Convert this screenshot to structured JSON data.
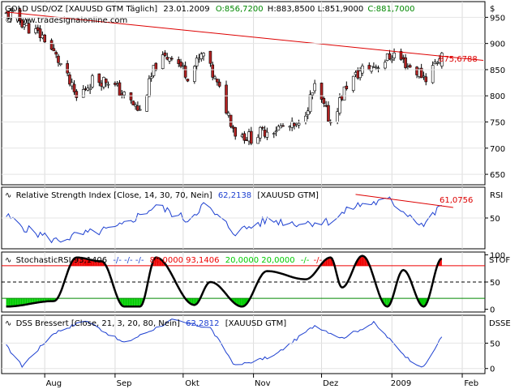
{
  "currency_label": "$",
  "main": {
    "symbol_label": "GOLD USD/OZ [XAUUSD GTM  Täglich]",
    "date": "23.01.2009",
    "open_label": "O:856,7200",
    "hl_label": "H:883,8500  L:851,9000",
    "close_label": "C:881,7000",
    "website": "© www.tradesignalonline.com",
    "trendline_value": "875,6788",
    "y_ticks": [
      "950",
      "900",
      "850",
      "800",
      "750",
      "700",
      "650"
    ]
  },
  "rsi": {
    "header": "Relative Strength Index [Close, 14, 30, 70, Nein]",
    "value": "62,2138",
    "symbol": "[XAUUSD GTM]",
    "trendline_value": "61,0756",
    "axis_label": "RSI",
    "y_ticks": [
      "50"
    ]
  },
  "stoch": {
    "header": "StochasticRSI 93,1406",
    "dashes": "-/- -/- -/-",
    "red_values": "80,0000 93,1406",
    "green_values": "20,0000 20,0000",
    "tail_green": "-/-",
    "tail_red": "-/-",
    "axis_label": "STOF",
    "y_ticks": [
      "100",
      "50",
      "0"
    ]
  },
  "dss": {
    "header": "DSS Bressert [Close, 21, 3, 20, 80, Nein]",
    "value": "62,2812",
    "symbol": "[XAUUSD GTM]",
    "axis_label": "DSSE",
    "y_ticks": [
      "50",
      "0"
    ]
  },
  "x_ticks": [
    "Aug",
    "Sep",
    "Okt",
    "Nov",
    "Dez",
    "2009",
    "Feb"
  ],
  "colors": {
    "up_candle": "#ffffff",
    "down_candle": "#b22222",
    "trendline": "#dd0000",
    "indicator_line": "#1c3fd0",
    "open_value": "#008800",
    "close_value": "#008800",
    "stoch_overbought": "#ee0000",
    "stoch_oversold": "#00cc00"
  },
  "chart_data": [
    {
      "type": "candlestick",
      "title": "GOLD USD/OZ [XAUUSD GTM  Täglich] 23.01.2009",
      "ylabel": "$",
      "ylim": [
        630,
        980
      ],
      "last_ohlc": {
        "open": 856.72,
        "high": 883.85,
        "low": 851.9,
        "close": 881.7
      },
      "approx_closes": [
        {
          "x": "2008-07-18",
          "y": 955
        },
        {
          "x": "2008-07-25",
          "y": 930
        },
        {
          "x": "2008-08-01",
          "y": 910
        },
        {
          "x": "2008-08-08",
          "y": 860
        },
        {
          "x": "2008-08-15",
          "y": 795
        },
        {
          "x": "2008-08-22",
          "y": 830
        },
        {
          "x": "2008-08-29",
          "y": 830
        },
        {
          "x": "2008-09-05",
          "y": 800
        },
        {
          "x": "2008-09-12",
          "y": 770
        },
        {
          "x": "2008-09-19",
          "y": 860
        },
        {
          "x": "2008-09-26",
          "y": 880
        },
        {
          "x": "2008-10-03",
          "y": 840
        },
        {
          "x": "2008-10-10",
          "y": 880
        },
        {
          "x": "2008-10-17",
          "y": 810
        },
        {
          "x": "2008-10-24",
          "y": 730
        },
        {
          "x": "2008-10-31",
          "y": 720
        },
        {
          "x": "2008-11-07",
          "y": 735
        },
        {
          "x": "2008-11-14",
          "y": 740
        },
        {
          "x": "2008-11-21",
          "y": 740
        },
        {
          "x": "2008-11-28",
          "y": 815
        },
        {
          "x": "2008-12-05",
          "y": 750
        },
        {
          "x": "2008-12-12",
          "y": 820
        },
        {
          "x": "2008-12-19",
          "y": 850
        },
        {
          "x": "2008-12-26",
          "y": 860
        },
        {
          "x": "2009-01-02",
          "y": 880
        },
        {
          "x": "2009-01-09",
          "y": 855
        },
        {
          "x": "2009-01-16",
          "y": 835
        },
        {
          "x": "2009-01-23",
          "y": 881.7
        }
      ],
      "trendline": {
        "x": [
          "2008-07-15",
          "2009-01-23"
        ],
        "y": [
          960,
          875.68
        ]
      },
      "x_ticks": [
        "Aug",
        "Sep",
        "Okt",
        "Nov",
        "Dez",
        "2009",
        "Feb"
      ],
      "y_ticks": [
        950,
        900,
        850,
        800,
        750,
        700,
        650
      ]
    },
    {
      "type": "line",
      "title": "Relative Strength Index [Close, 14, 30, 70, Nein] 62,2138 [XAUUSD GTM]",
      "ylim": [
        20,
        80
      ],
      "series": [
        {
          "name": "Relative Strength Index",
          "values": [
            {
              "x": "2008-07-15",
              "y": 52
            },
            {
              "x": "2008-07-25",
              "y": 38
            },
            {
              "x": "2008-08-06",
              "y": 28
            },
            {
              "x": "2008-08-15",
              "y": 33
            },
            {
              "x": "2008-09-02",
              "y": 40
            },
            {
              "x": "2008-09-19",
              "y": 62
            },
            {
              "x": "2008-10-03",
              "y": 48
            },
            {
              "x": "2008-10-10",
              "y": 63
            },
            {
              "x": "2008-10-24",
              "y": 36
            },
            {
              "x": "2008-11-07",
              "y": 48
            },
            {
              "x": "2008-11-21",
              "y": 45
            },
            {
              "x": "2008-12-05",
              "y": 47
            },
            {
              "x": "2008-12-16",
              "y": 62
            },
            {
              "x": "2008-12-31",
              "y": 67
            },
            {
              "x": "2009-01-15",
              "y": 43
            },
            {
              "x": "2009-01-23",
              "y": 62.21
            }
          ]
        }
      ],
      "trendline": {
        "x": [
          "2008-12-16",
          "2009-01-23"
        ],
        "y": [
          73,
          61.08
        ]
      },
      "y_ticks": [
        50
      ]
    },
    {
      "type": "line",
      "title": "StochasticRSI 93,1406",
      "ylim": [
        -5,
        105
      ],
      "levels": {
        "overbought": 80,
        "oversold": 20
      },
      "series": [
        {
          "name": "StochasticRSI",
          "values": [
            {
              "x": "2008-07-15",
              "y": 5
            },
            {
              "x": "2008-08-05",
              "y": 15
            },
            {
              "x": "2008-08-15",
              "y": 95
            },
            {
              "x": "2008-08-26",
              "y": 88
            },
            {
              "x": "2008-09-05",
              "y": 5
            },
            {
              "x": "2008-09-12",
              "y": 5
            },
            {
              "x": "2008-09-19",
              "y": 95
            },
            {
              "x": "2008-10-06",
              "y": 8
            },
            {
              "x": "2008-10-13",
              "y": 50
            },
            {
              "x": "2008-10-27",
              "y": 5
            },
            {
              "x": "2008-11-07",
              "y": 70
            },
            {
              "x": "2008-11-24",
              "y": 55
            },
            {
              "x": "2008-12-05",
              "y": 95
            },
            {
              "x": "2008-12-10",
              "y": 40
            },
            {
              "x": "2008-12-19",
              "y": 98
            },
            {
              "x": "2008-12-30",
              "y": 5
            },
            {
              "x": "2009-01-06",
              "y": 72
            },
            {
              "x": "2009-01-15",
              "y": 5
            },
            {
              "x": "2009-01-23",
              "y": 93.14
            }
          ]
        }
      ],
      "y_ticks": [
        100,
        50,
        0
      ]
    },
    {
      "type": "line",
      "title": "DSS Bressert [Close, 21, 3, 20, 80, Nein] 62,2812 [XAUUSD GTM]",
      "ylim": [
        -10,
        105
      ],
      "series": [
        {
          "name": "DSS Bressert",
          "values": [
            {
              "x": "2008-07-15",
              "y": 45
            },
            {
              "x": "2008-07-22",
              "y": 5
            },
            {
              "x": "2008-08-05",
              "y": 70
            },
            {
              "x": "2008-08-19",
              "y": 95
            },
            {
              "x": "2008-09-05",
              "y": 50
            },
            {
              "x": "2008-09-26",
              "y": 95
            },
            {
              "x": "2008-10-13",
              "y": 80
            },
            {
              "x": "2008-10-24",
              "y": 5
            },
            {
              "x": "2008-11-10",
              "y": 25
            },
            {
              "x": "2008-11-28",
              "y": 85
            },
            {
              "x": "2008-12-10",
              "y": 60
            },
            {
              "x": "2008-12-24",
              "y": 90
            },
            {
              "x": "2009-01-08",
              "y": 20
            },
            {
              "x": "2009-01-15",
              "y": 2
            },
            {
              "x": "2009-01-23",
              "y": 62.28
            }
          ]
        }
      ],
      "y_ticks": [
        50,
        0
      ]
    }
  ]
}
